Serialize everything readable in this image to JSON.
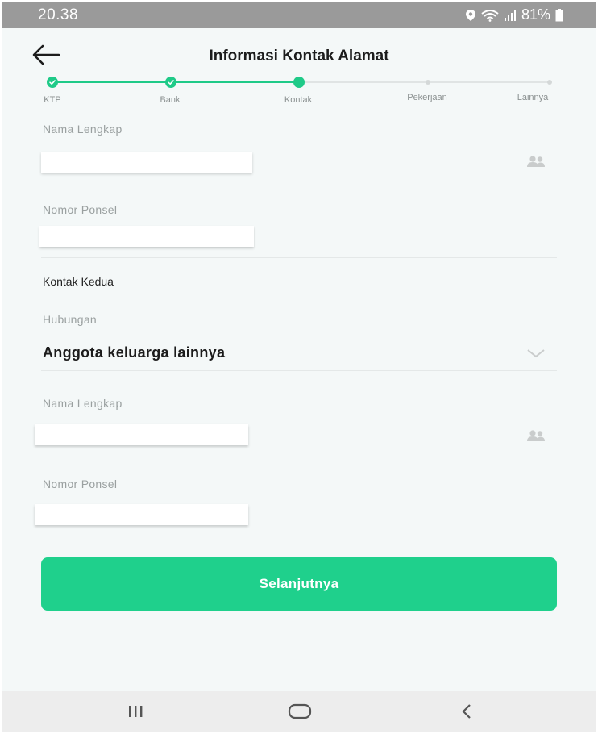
{
  "status_bar": {
    "time": "20.38",
    "battery": "81%"
  },
  "header": {
    "title": "Informasi Kontak Alamat"
  },
  "stepper": {
    "steps": [
      {
        "label": "KTP",
        "state": "done"
      },
      {
        "label": "Bank",
        "state": "done"
      },
      {
        "label": "Kontak",
        "state": "current"
      },
      {
        "label": "Pekerjaan",
        "state": "pending"
      },
      {
        "label": "Lainnya",
        "state": "pending"
      }
    ]
  },
  "form": {
    "primary_contact": {
      "name_label": "Nama Lengkap",
      "phone_label": "Nomor Ponsel"
    },
    "second_contact_title": "Kontak Kedua",
    "relationship": {
      "label": "Hubungan",
      "value": "Anggota keluarga lainnya"
    },
    "secondary_contact": {
      "name_label": "Nama Lengkap",
      "phone_label": "Nomor Ponsel"
    }
  },
  "next_button": {
    "label": "Selanjutnya"
  },
  "colors": {
    "accent": "#1fd08c",
    "background": "#f4f8f8"
  },
  "icons": {
    "back": "arrow-left-icon",
    "contacts": "contacts-icon",
    "dropdown": "chevron-down-icon",
    "recent_apps": "recent-apps-icon",
    "home": "home-icon",
    "nav_back": "nav-back-icon"
  }
}
